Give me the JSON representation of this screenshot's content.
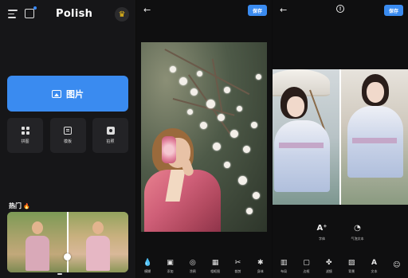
{
  "home": {
    "app_title": "Polish",
    "main_button_label": "图片",
    "tools": [
      {
        "label": "拼图",
        "icon": "grid-icon"
      },
      {
        "label": "模板",
        "icon": "template-icon"
      },
      {
        "label": "拍照",
        "icon": "camera-icon"
      }
    ],
    "hot_title": "热门",
    "icons": [
      "menu-icon",
      "store-icon",
      "crown-icon",
      "image-icon",
      "fire-icon"
    ]
  },
  "editor": {
    "save_label": "保存",
    "toolbar": [
      {
        "label": "模糊",
        "icon": "droplet-icon"
      },
      {
        "label": "添加",
        "icon": "image-icon"
      },
      {
        "label": "涂鸦",
        "icon": "brush-icon"
      },
      {
        "label": "相框图",
        "icon": "frame-icon"
      },
      {
        "label": "裁剪",
        "icon": "scissors-icon"
      },
      {
        "label": "身体",
        "icon": "body-icon"
      }
    ]
  },
  "text_editor": {
    "save_label": "保存",
    "text_tools": [
      {
        "label": "字体",
        "glyph": "A⁺"
      },
      {
        "label": "气泡文本",
        "glyph": "◔"
      }
    ],
    "toolbar": [
      {
        "label": "布局",
        "icon": "layout-icon"
      },
      {
        "label": "边框",
        "icon": "border-icon"
      },
      {
        "label": "滤镜",
        "icon": "filter-icon"
      },
      {
        "label": "背景",
        "icon": "background-icon"
      },
      {
        "label": "文本",
        "icon": "text-icon"
      },
      {
        "label": "",
        "icon": "sticker-icon"
      }
    ]
  }
}
